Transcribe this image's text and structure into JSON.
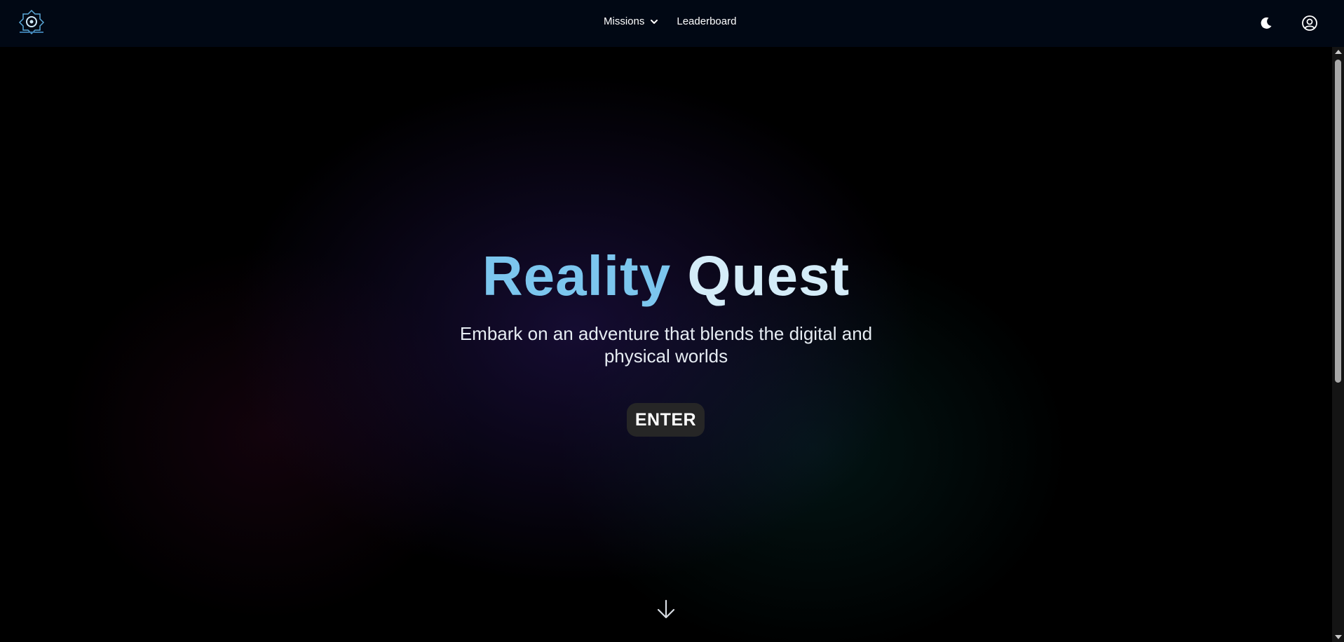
{
  "header": {
    "logo_icon": "reality-quest-logo",
    "nav": {
      "missions_label": "Missions",
      "missions_icon": "chevron-down-icon",
      "leaderboard_label": "Leaderboard"
    },
    "theme_toggle_icon": "moon-icon",
    "account_icon": "user-circle-icon"
  },
  "hero": {
    "title_word_1": "Reality",
    "title_word_2": "Quest",
    "subtitle": "Embark on an adventure that blends the digital and physical worlds",
    "enter_label": "ENTER",
    "scroll_icon": "arrow-down-icon"
  },
  "colors": {
    "title_primary": "#7cc6ee",
    "title_secondary": "#d4ecf8",
    "header_bg": "#010814",
    "button_bg": "#262626",
    "page_bg": "#000000"
  }
}
